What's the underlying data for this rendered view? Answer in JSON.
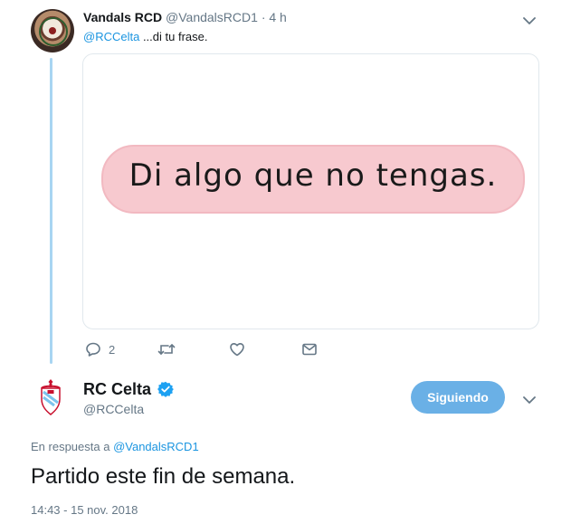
{
  "tweet1": {
    "name": "Vandals RCD",
    "handle": "@VandalsRCD1",
    "separator": "·",
    "time": "4 h",
    "reply_mention": "@RCCelta",
    "reply_rest": " ...di tu frase.",
    "image_text": "Di algo que no tengas.",
    "actions": {
      "reply_count": "2",
      "retweet_count": "",
      "like_count": ""
    }
  },
  "tweet2": {
    "name": "RC Celta",
    "handle": "@RCCelta",
    "follow_label": "Siguiendo",
    "in_reply_prefix": "En respuesta a ",
    "in_reply_mention": "@VandalsRCD1",
    "text": "Partido este fin de semana.",
    "timestamp": "14:43 - 15 nov. 2018"
  },
  "colors": {
    "accent": "#1b95e0",
    "follow_button": "#6ab0e6",
    "thread_line": "#a8d5f2",
    "image_pill": "#f7c9cf"
  },
  "icons": [
    "chevron-down-icon",
    "reply-icon",
    "retweet-icon",
    "like-icon",
    "message-icon",
    "verified-icon"
  ]
}
